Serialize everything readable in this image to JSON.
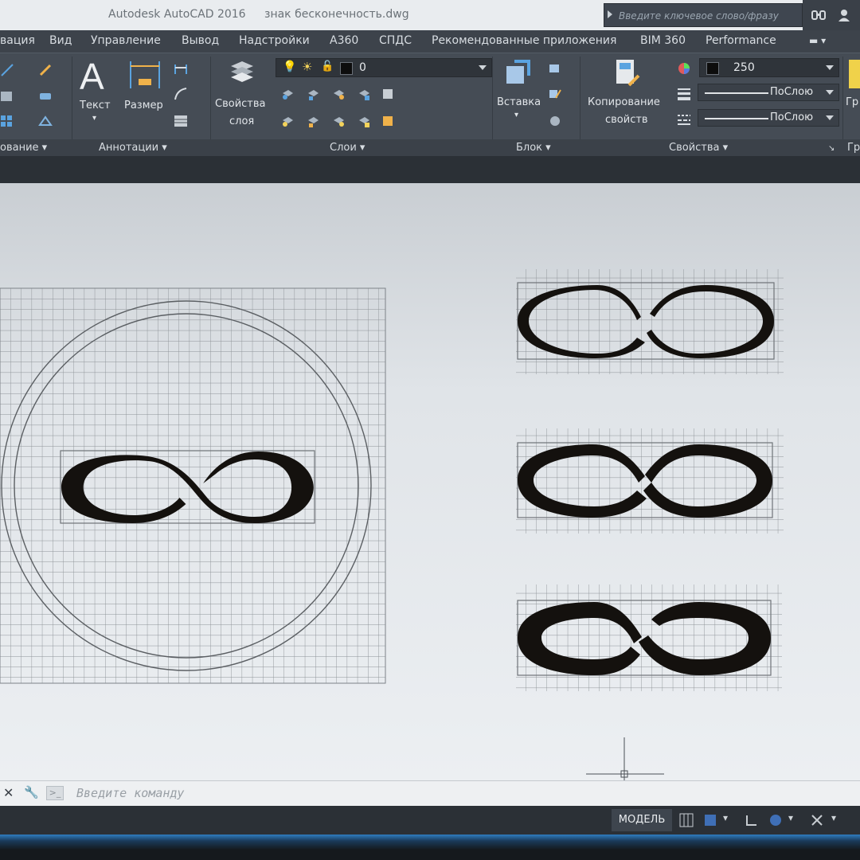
{
  "titlebar": {
    "app": "Autodesk AutoCAD 2016",
    "file": "знак бесконечность.dwg",
    "search_placeholder": "Введите ключевое слово/фразу"
  },
  "menu": [
    "вация",
    "Вид",
    "Управление",
    "Вывод",
    "Надстройки",
    "А360",
    "СПДС",
    "Рекомендованные приложения",
    "BIM 360",
    "Performance"
  ],
  "ribbon": {
    "text_label": "Текст",
    "dimension_label": "Размер",
    "layer_props_label_1": "Свойства",
    "layer_props_label_2": "слоя",
    "layer_value": "0",
    "insert_label": "Вставка",
    "copy_props_label_1": "Копирование",
    "copy_props_label_2": "свойств",
    "color_value": "250",
    "linetype_value": "ПоСлою",
    "lineweight_value": "ПоСлою",
    "groups_label": "Гр",
    "panels": {
      "draw": "ование",
      "annotations": "Аннотации",
      "layers": "Слои",
      "block": "Блок",
      "properties": "Свойства",
      "groups": "Гр"
    }
  },
  "command": {
    "placeholder": "Введите команду"
  },
  "status": {
    "model": "МОДЕЛЬ"
  },
  "colors": {
    "ribbon_bg": "#454c55",
    "canvas_bg": "#e6e9ec",
    "grid": "#8c9196",
    "ink": "#14110e"
  }
}
